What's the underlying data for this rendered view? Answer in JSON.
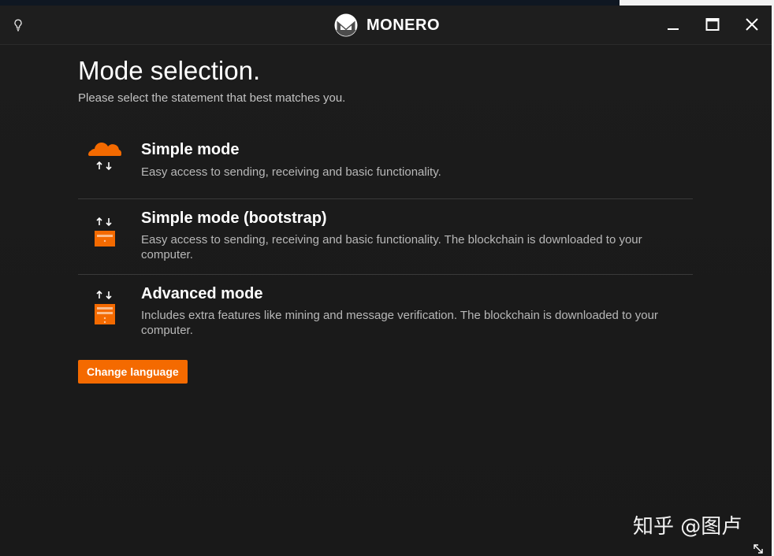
{
  "window": {
    "title": "MONERO"
  },
  "page": {
    "title": "Mode selection.",
    "subtitle": "Please select the statement that best matches you."
  },
  "modes": [
    {
      "title": "Simple mode",
      "description": "Easy access to sending, receiving and basic functionality."
    },
    {
      "title": "Simple mode (bootstrap)",
      "description": "Easy access to sending, receiving and basic functionality. The blockchain is downloaded to your computer."
    },
    {
      "title": "Advanced mode",
      "description": "Includes extra features like mining and message verification. The blockchain is downloaded to your computer."
    }
  ],
  "actions": {
    "change_language": "Change language"
  },
  "watermark": "知乎 @图卢",
  "icons": {
    "theme": "lightbulb-icon",
    "logo": "monero-logo-icon",
    "minimize": "minimize-icon",
    "maximize": "maximize-icon",
    "close": "close-icon",
    "simple": "cloud-icon",
    "bootstrap": "server-icon",
    "advanced": "server-tower-icon",
    "resize": "resize-grip-icon"
  },
  "colors": {
    "accent": "#f46a00",
    "background": "#1b1b1b",
    "text_secondary": "#b8b8b8"
  }
}
